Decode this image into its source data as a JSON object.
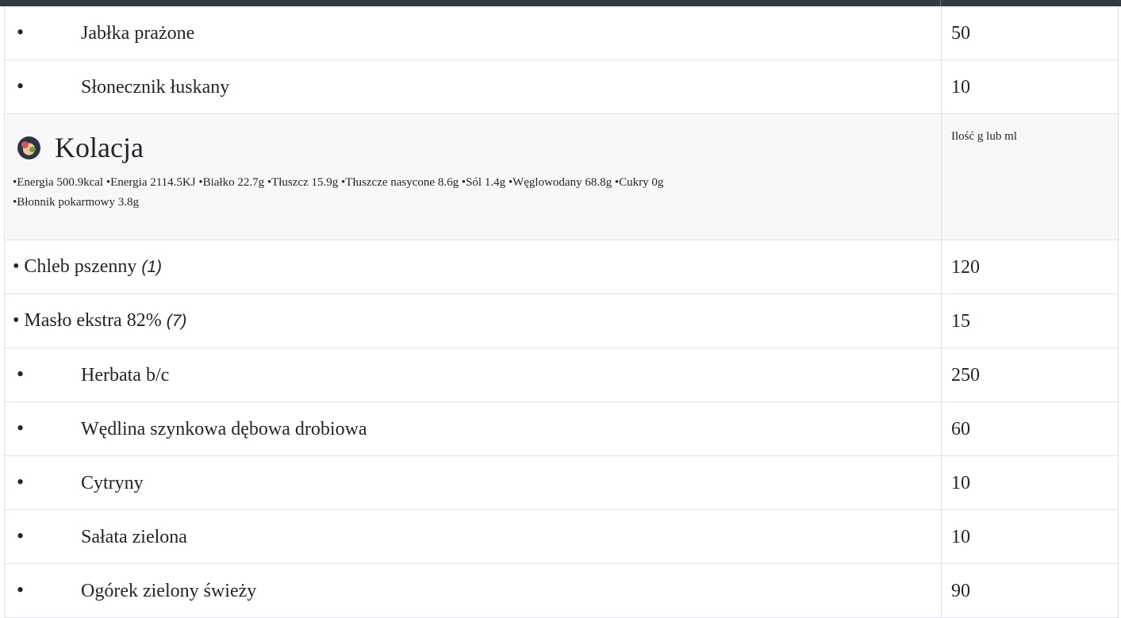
{
  "table": {
    "rows_before": [
      {
        "name": "Jabłka prażone",
        "qty": "50"
      },
      {
        "name": "Słonecznik łuskany",
        "qty": "10"
      }
    ],
    "meal": {
      "title": "Kolacja",
      "icon": "meal-dish-icon",
      "nutrition_line1": "•Energia 500.9kcal •Energia 2114.5KJ •Białko 22.7g •Tłuszcz 15.9g •Tłuszcze nasycone 8.6g •Sól 1.4g •Węglowodany 68.8g •Cukry 0g",
      "nutrition_line2": "•Błonnik pokarmowy 3.8g",
      "qty_header": "Ilość g lub ml"
    },
    "inline_rows": [
      {
        "name": "• Chleb pszenny",
        "allergen": "(1)",
        "qty": "120"
      },
      {
        "name": "• Masło ekstra 82%",
        "allergen": "(7)",
        "qty": "15"
      }
    ],
    "rows_after": [
      {
        "name": "Herbata b/c",
        "qty": "250"
      },
      {
        "name": "Wędlina szynkowa dębowa drobiowa",
        "qty": "60"
      },
      {
        "name": "Cytryny",
        "qty": "10"
      },
      {
        "name": "Sałata zielona",
        "qty": "10"
      },
      {
        "name": "Ogórek zielony świeży",
        "qty": "90"
      }
    ],
    "bullet": "•"
  },
  "colors": {
    "header_bar": "#343a40",
    "meal_row_bg": "#f8f8f8",
    "border": "#dee2e6"
  }
}
